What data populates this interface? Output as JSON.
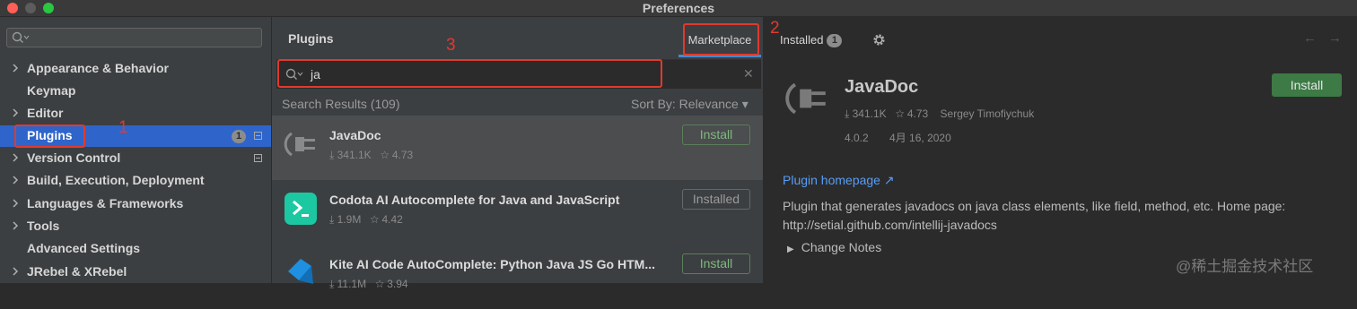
{
  "window": {
    "title": "Preferences"
  },
  "sidebar": {
    "search_value": "",
    "items": [
      {
        "label": "Appearance & Behavior",
        "expandable": true,
        "selected": false
      },
      {
        "label": "Keymap",
        "expandable": false,
        "selected": false
      },
      {
        "label": "Editor",
        "expandable": true,
        "selected": false
      },
      {
        "label": "Plugins",
        "expandable": false,
        "selected": true,
        "badge": "1"
      },
      {
        "label": "Version Control",
        "expandable": true,
        "selected": false
      },
      {
        "label": "Build, Execution, Deployment",
        "expandable": true,
        "selected": false
      },
      {
        "label": "Languages & Frameworks",
        "expandable": true,
        "selected": false
      },
      {
        "label": "Tools",
        "expandable": true,
        "selected": false
      },
      {
        "label": "Advanced Settings",
        "expandable": false,
        "selected": false
      },
      {
        "label": "JRebel & XRebel",
        "expandable": true,
        "selected": false
      }
    ]
  },
  "header": {
    "title": "Plugins",
    "tabs": {
      "marketplace": "Marketplace",
      "installed": "Installed",
      "installed_count": "1"
    }
  },
  "search": {
    "value": "ja",
    "results_text": "Search Results (109)",
    "sort_text": "Sort By: Relevance ▾"
  },
  "plugins": [
    {
      "name": "JavaDoc",
      "downloads": "⤓ 341.1K",
      "rating": "☆ 4.73",
      "action": "Install"
    },
    {
      "name": "Codota AI Autocomplete for Java and JavaScript",
      "downloads": "⤓ 1.9M",
      "rating": "☆ 4.42",
      "action": "Installed"
    },
    {
      "name": "Kite AI Code AutoComplete: Python Java JS Go HTM...",
      "downloads": "⤓ 11.1M",
      "rating": "☆ 3.94",
      "action": "Install"
    }
  ],
  "detail": {
    "name": "JavaDoc",
    "downloads": "⤓ 341.1K",
    "rating": "☆ 4.73",
    "author": "Sergey Timofiychuk",
    "version": "4.0.2",
    "date": "4月 16, 2020",
    "install_label": "Install",
    "homepage_label": "Plugin homepage ↗",
    "description": "Plugin that generates javadocs on java class elements, like field, method, etc. Home page: http://setial.github.com/intellij-javadocs",
    "change_notes_label": "Change Notes"
  },
  "annotations": {
    "n1": "1",
    "n2": "2",
    "n3": "3"
  },
  "watermark": "@稀土掘金技术社区",
  "colors": {
    "accent": "#2f65ca",
    "annotation": "#e03a2f",
    "install_green": "#3d7a45",
    "link": "#589df6"
  },
  "icons": [
    "search-icon",
    "chevron-right-icon",
    "plugin-plug-icon",
    "codota-icon",
    "kite-icon",
    "gear-icon",
    "back-arrow-icon",
    "forward-arrow-icon",
    "clear-icon"
  ]
}
